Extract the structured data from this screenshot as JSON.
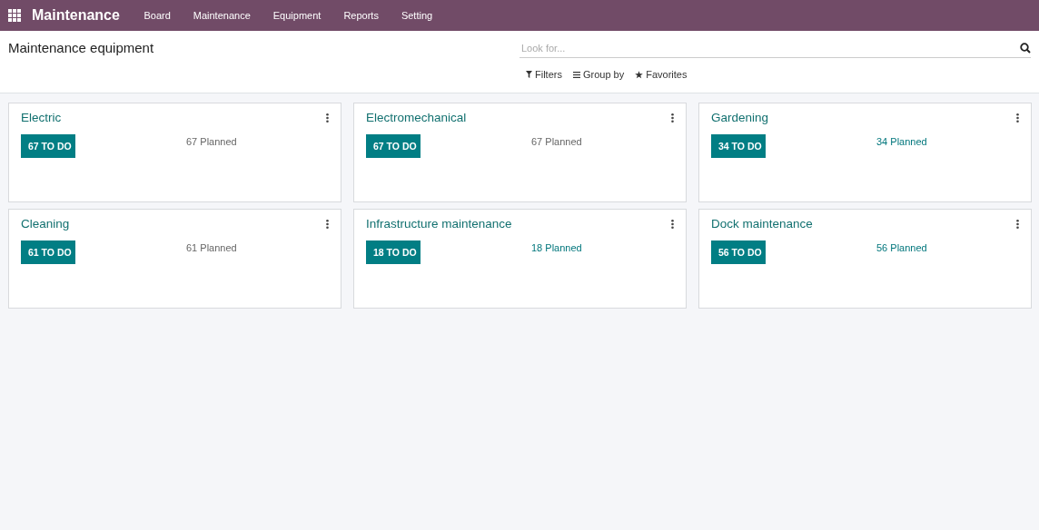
{
  "app": {
    "name": "Maintenance"
  },
  "menu": [
    "Board",
    "Maintenance",
    "Equipment",
    "Reports",
    "Setting"
  ],
  "page_title": "Maintenance equipment",
  "search": {
    "placeholder": "Look for..."
  },
  "search_options": [
    {
      "label": "Filters",
      "kind": "filter"
    },
    {
      "label": "Group by",
      "kind": "group"
    },
    {
      "label": "Favorites",
      "kind": "star"
    }
  ],
  "cards": [
    {
      "title": "Electric",
      "todo": "67 TO DO",
      "planned": "67 Planned",
      "planned_highlighted": false
    },
    {
      "title": "Electromechanical",
      "todo": "67 TO DO",
      "planned": "67 Planned",
      "planned_highlighted": false
    },
    {
      "title": "Gardening",
      "todo": "34 TO DO",
      "planned": "34 Planned",
      "planned_highlighted": true
    },
    {
      "title": "Cleaning",
      "todo": "61 TO DO",
      "planned": "61 Planned",
      "planned_highlighted": false
    },
    {
      "title": "Infrastructure maintenance",
      "todo": "18 TO DO",
      "planned": "18 Planned",
      "planned_highlighted": true
    },
    {
      "title": "Dock maintenance",
      "todo": "56 TO DO",
      "planned": "56 Planned",
      "planned_highlighted": true
    }
  ]
}
